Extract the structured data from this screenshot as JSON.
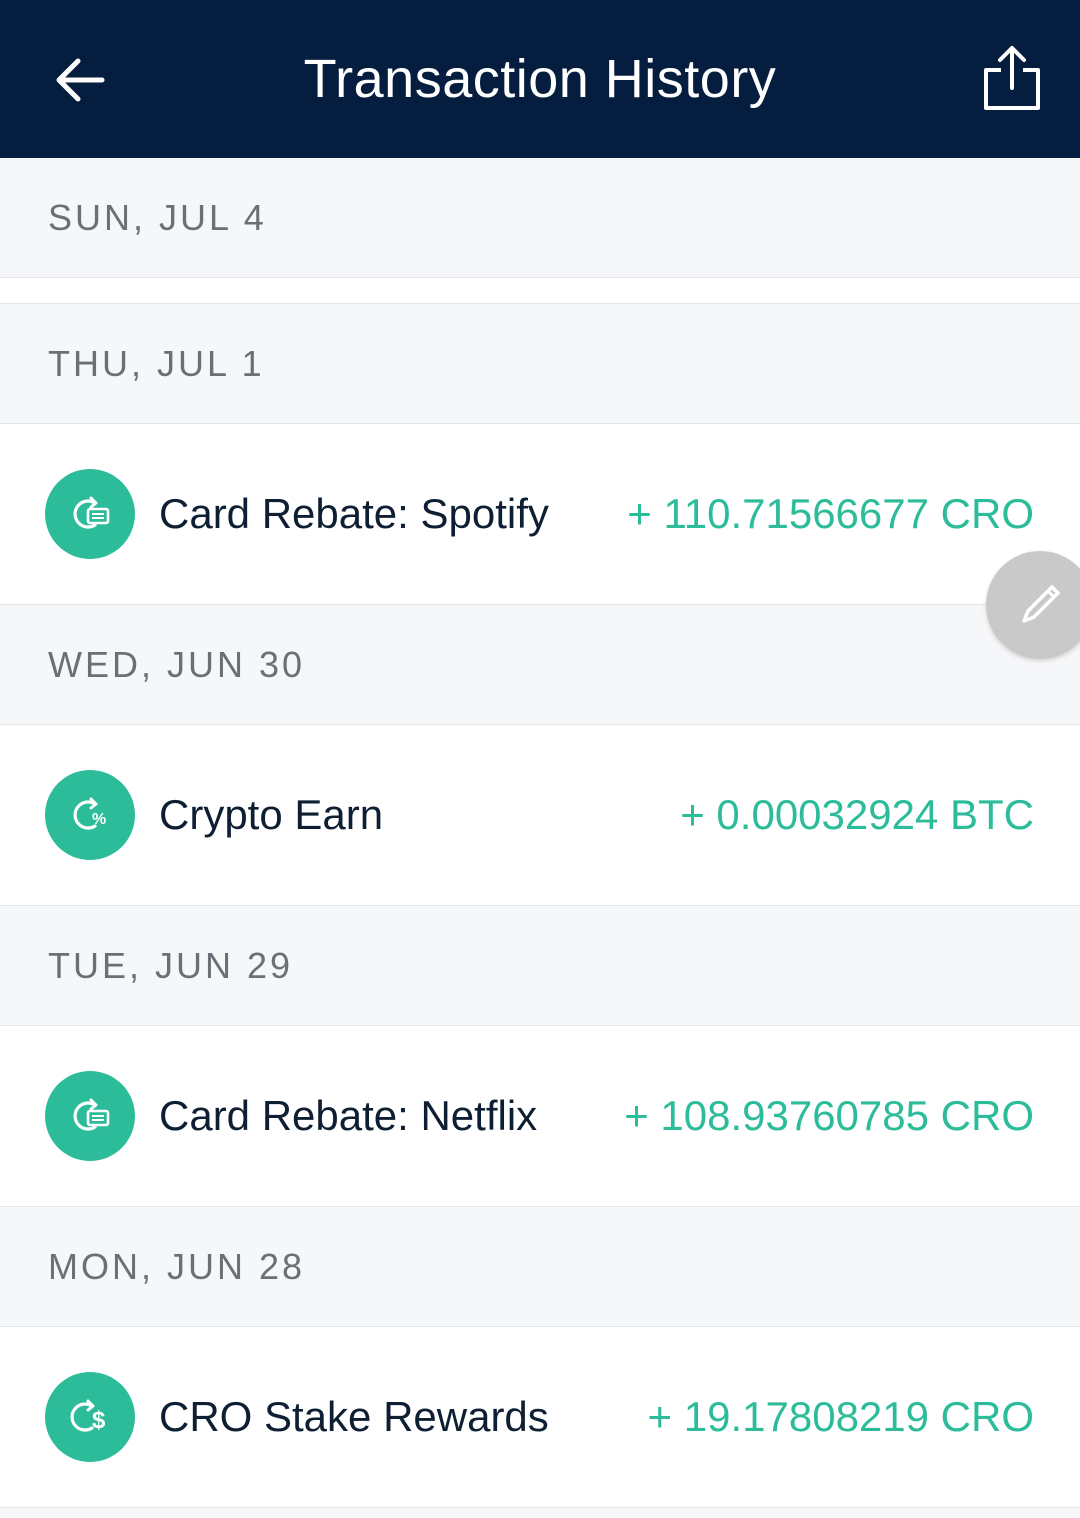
{
  "header": {
    "title": "Transaction History",
    "back_icon": "arrow-left-icon",
    "share_icon": "share-export-icon"
  },
  "colors": {
    "header_bg": "#051d3f",
    "accent_green": "#2cbc9a",
    "fab_bg": "#c9c9c9"
  },
  "groups": [
    {
      "date": "SUN, JUL 4",
      "transactions": []
    },
    {
      "date": "THU, JUL 1",
      "transactions": [
        {
          "icon": "card-rebate-icon",
          "label": "Card Rebate: Spotify",
          "amount": "+ 110.71566677 CRO"
        }
      ]
    },
    {
      "date": "WED, JUN 30",
      "transactions": [
        {
          "icon": "crypto-earn-icon",
          "label": "Crypto Earn",
          "amount": "+ 0.00032924 BTC"
        }
      ]
    },
    {
      "date": "TUE, JUN 29",
      "transactions": [
        {
          "icon": "card-rebate-icon",
          "label": "Card Rebate: Netflix",
          "amount": "+ 108.93760785 CRO"
        }
      ]
    },
    {
      "date": "MON, JUN 28",
      "transactions": [
        {
          "icon": "stake-rewards-icon",
          "label": "CRO Stake Rewards",
          "amount": "+ 19.17808219 CRO"
        }
      ]
    }
  ],
  "fab": {
    "icon": "pencil-edit-icon"
  }
}
